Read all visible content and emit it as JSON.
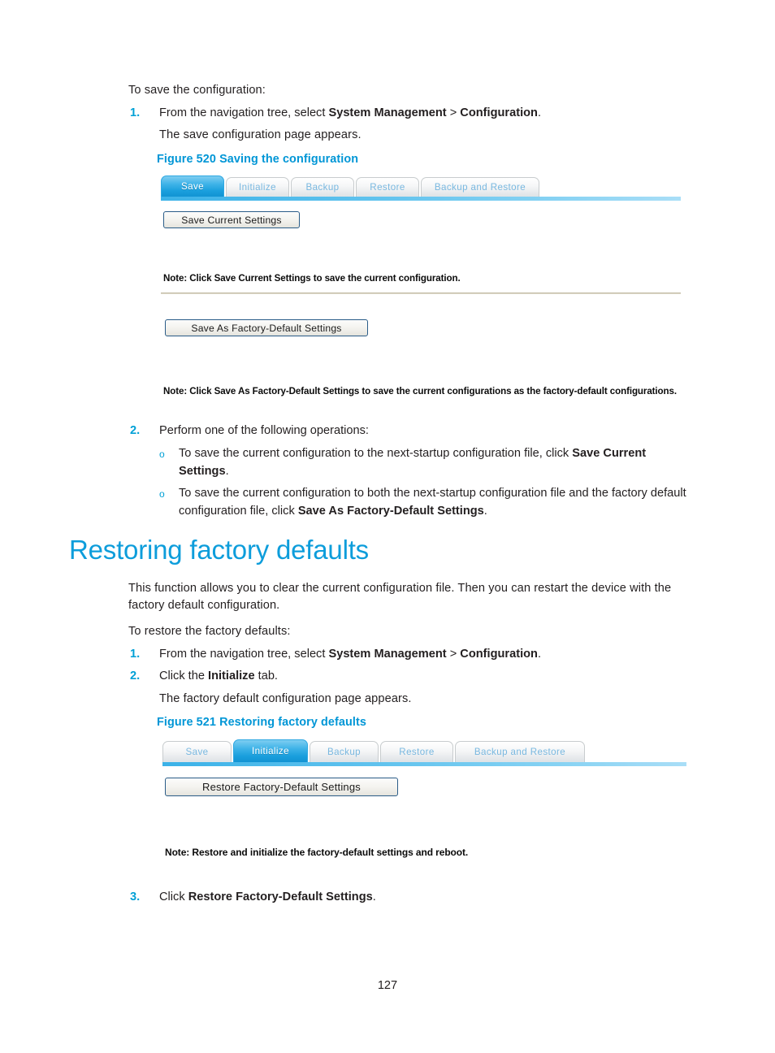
{
  "document": {
    "page_number": "127",
    "accent_blue": "#00a0d6",
    "heading_blue": "#0d9ddb",
    "caption_blue": "#0096d6"
  },
  "section_save": {
    "intro": "To save the configuration:",
    "step1": {
      "number": "1.",
      "text_before": "From the navigation tree, select ",
      "bold1": "System Management",
      "separator": " > ",
      "bold2": "Configuration",
      "text_after": "."
    },
    "step1_result": "The save configuration page appears.",
    "figure_caption": "Figure 520 Saving the configuration",
    "step2": {
      "number": "2.",
      "text": "Perform one of the following operations:"
    },
    "bullets": [
      {
        "marker": "o",
        "text_before": "To save the current configuration to the next-startup configuration file, click ",
        "bold": "Save Current Settings",
        "text_after": "."
      },
      {
        "marker": "o",
        "text_before": "To save the current configuration to both the next-startup configuration file and the factory default configuration file, click ",
        "bold": "Save As Factory-Default Settings",
        "text_after": "."
      }
    ]
  },
  "figure_520": {
    "tabs": [
      {
        "label": "Save",
        "active": true
      },
      {
        "label": "Initialize",
        "active": false
      },
      {
        "label": "Backup",
        "active": false
      },
      {
        "label": "Restore",
        "active": false
      },
      {
        "label": "Backup and Restore",
        "active": false
      }
    ],
    "save_current_button": "Save Current Settings",
    "note_1": "Note: Click Save Current Settings to save the current configuration.",
    "save_factory_button": "Save As Factory-Default Settings",
    "note_2": "Note: Click Save As Factory-Default Settings to save the current configurations as the factory-default configurations."
  },
  "section_restore": {
    "heading": "Restoring factory defaults",
    "paragraph": "This function allows you to clear the current configuration file. Then you can restart the device with the factory default configuration.",
    "intro": "To restore the factory defaults:",
    "step1": {
      "number": "1.",
      "text_before": "From the navigation tree, select ",
      "bold1": "System Management",
      "separator": " > ",
      "bold2": "Configuration",
      "text_after": "."
    },
    "step2": {
      "number": "2.",
      "text_before": "Click the ",
      "bold": "Initialize",
      "text_after": " tab."
    },
    "step2_result": "The factory default configuration page appears.",
    "figure_caption": "Figure 521 Restoring factory defaults",
    "step3": {
      "number": "3.",
      "text_before": "Click ",
      "bold": "Restore Factory-Default Settings",
      "text_after": "."
    }
  },
  "figure_521": {
    "tabs": [
      {
        "label": "Save",
        "active": false
      },
      {
        "label": "Initialize",
        "active": true
      },
      {
        "label": "Backup",
        "active": false
      },
      {
        "label": "Restore",
        "active": false
      },
      {
        "label": "Backup and Restore",
        "active": false
      }
    ],
    "restore_button": "Restore Factory-Default Settings",
    "note": "Note: Restore and initialize the factory-default settings and reboot."
  }
}
